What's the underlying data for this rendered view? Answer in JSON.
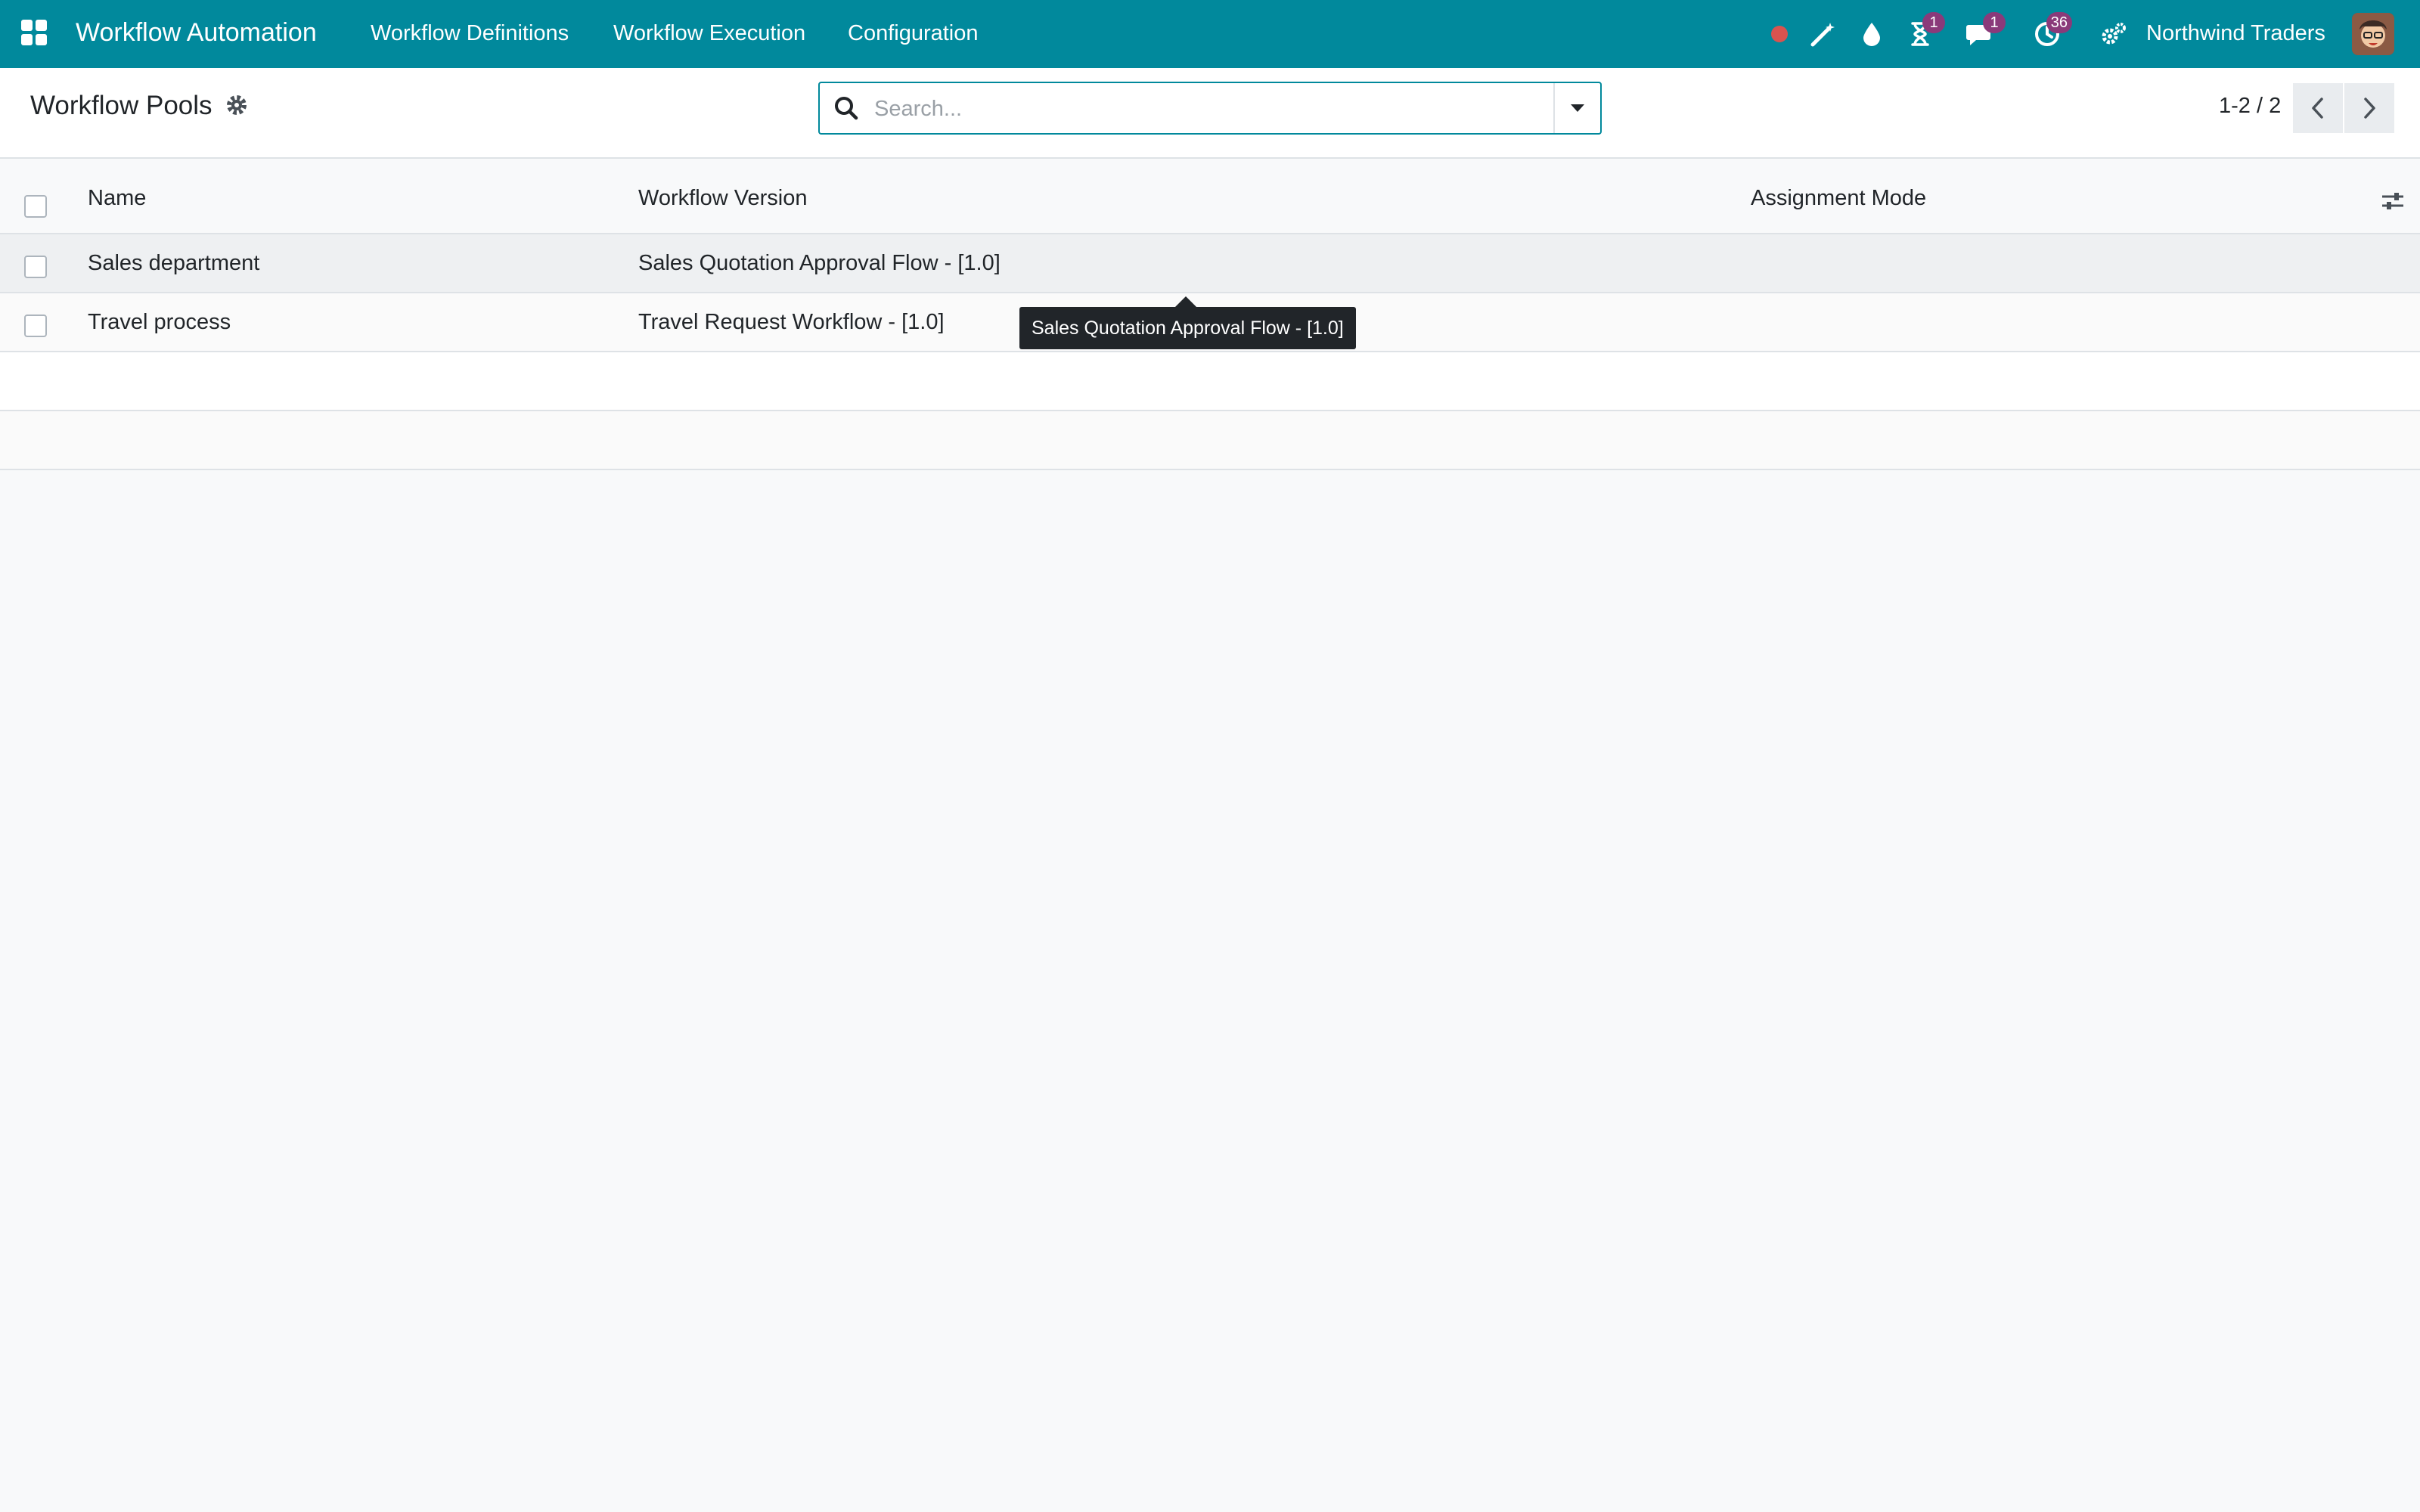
{
  "navbar": {
    "app_title": "Workflow Automation",
    "menu": [
      {
        "label": "Workflow Definitions"
      },
      {
        "label": "Workflow Execution"
      },
      {
        "label": "Configuration"
      }
    ],
    "activity_badge": "1",
    "messages_badge": "1",
    "timer_badge": "36",
    "company": "Northwind Traders",
    "icons": [
      "apps-grid-icon",
      "record-dot-icon",
      "magic-wand-icon",
      "droplet-icon",
      "hourglass-icon",
      "chat-icon",
      "clock-icon",
      "settings-cogs-icon"
    ]
  },
  "control_panel": {
    "title": "Workflow Pools",
    "search_placeholder": "Search...",
    "pager_value": "1-2 / 2"
  },
  "list": {
    "columns": {
      "name": "Name",
      "workflow_version": "Workflow Version",
      "assignment_mode": "Assignment Mode"
    },
    "rows": [
      {
        "name": "Sales department",
        "workflow_version": "Sales Quotation Approval Flow - [1.0]",
        "assignment_mode": ""
      },
      {
        "name": "Travel process",
        "workflow_version": "Travel Request Workflow - [1.0]",
        "assignment_mode": ""
      }
    ]
  },
  "tooltip": {
    "text": "Sales Quotation Approval Flow - [1.0]"
  },
  "colors": {
    "navbar": "#01899c",
    "badge": "#8a3a7a",
    "record_dot": "#d9534f"
  }
}
